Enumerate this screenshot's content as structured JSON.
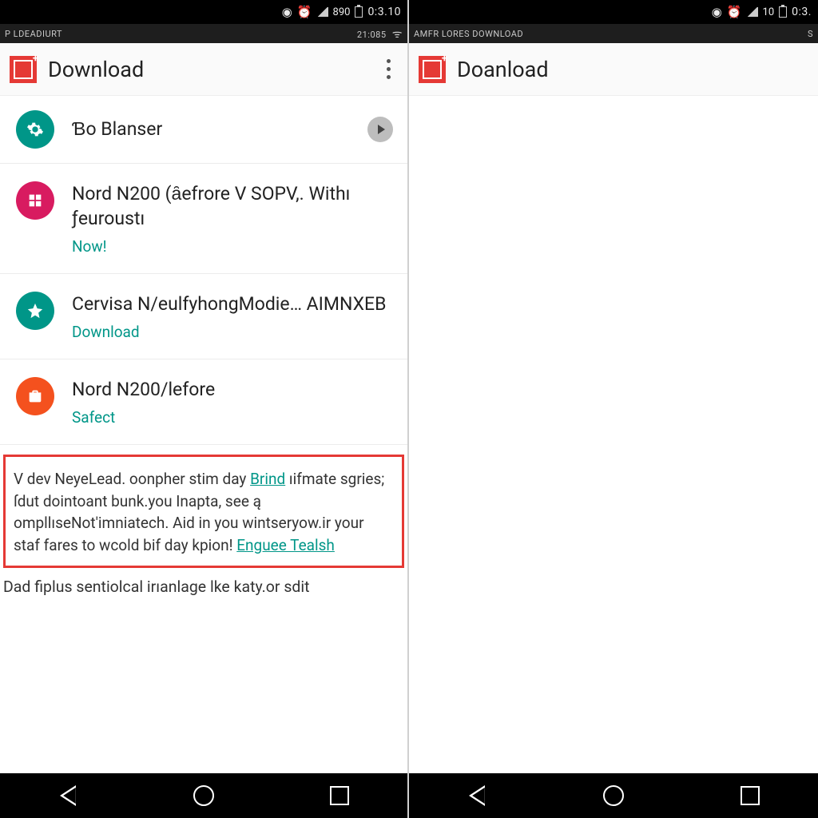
{
  "left": {
    "statusbar": {
      "signal_label": "890",
      "time": "0:3.10"
    },
    "carrierbar": {
      "left": "P LDEADIURT",
      "right": "21:085"
    },
    "appbar": {
      "title": "Download"
    },
    "rows": [
      {
        "avatar_color": "teal",
        "avatar_icon": "gear",
        "title": "Ɓo Blanser",
        "action": "",
        "has_play": true
      },
      {
        "avatar_color": "red",
        "avatar_icon": "grid",
        "title": "Nord N200 (ȃefrore V SOPV,. Withı ƒeuroustı",
        "action": "Now!",
        "has_play": false
      },
      {
        "avatar_color": "teal",
        "avatar_icon": "star",
        "title": "Cervisa N/eulfyhongModie… AIMNXEB",
        "action": "Download",
        "has_play": false
      },
      {
        "avatar_color": "orange",
        "avatar_icon": "briefcase",
        "title": "Nord N200/lefore",
        "action": "Safect",
        "has_play": false
      }
    ],
    "promo": {
      "text_before_link1": "V dev NeyeLead. oonpher stim day ",
      "link1": "Brind",
      "text_mid": " ıifmate sgries; ſdut dointoant bunk.you Inapta, see ą ompllıseNot'imniatech. Aid in you wintseryow.ir your staf fares to wcold bif day kpion! ",
      "link2": "Enguee Tealsh"
    },
    "trailing": "Dad fiplus sentiolcal irıanlage lke katy.or sdit"
  },
  "right": {
    "statusbar": {
      "signal_label": "10",
      "time": "0:3."
    },
    "carrierbar": {
      "left": "AMFR LORES DOWNLOAD",
      "right": "S"
    },
    "appbar": {
      "title": "Doanload"
    }
  }
}
